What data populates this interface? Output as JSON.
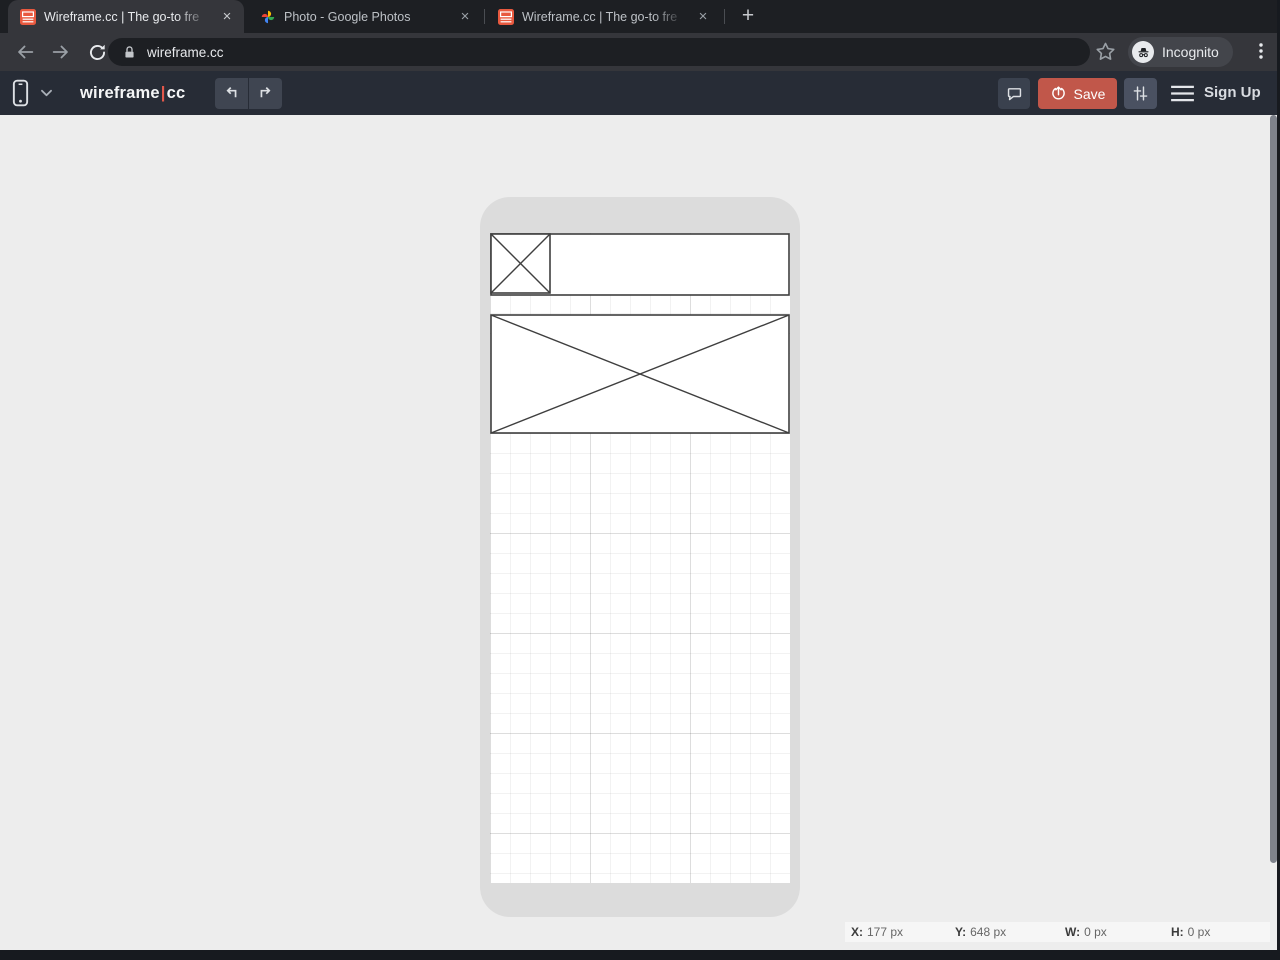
{
  "browser": {
    "tabs": [
      {
        "title": "Wireframe.cc | The go-to fre",
        "favicon": "wireframe",
        "active": true
      },
      {
        "title": "Photo - Google Photos",
        "favicon": "google-photos",
        "active": false
      },
      {
        "title": "Wireframe.cc | The go-to fre",
        "favicon": "wireframe",
        "active": false
      }
    ],
    "close_glyph": "×",
    "new_tab_glyph": "+",
    "url": "wireframe.cc",
    "incognito_label": "Incognito"
  },
  "toolbar": {
    "logo_left": "wireframe",
    "logo_cursor": "|",
    "logo_right": "cc",
    "save_label": "Save",
    "signup_label": "Sign Up"
  },
  "status_bar": {
    "items": [
      {
        "label": "X:",
        "value": "177 px"
      },
      {
        "label": "Y:",
        "value": "648 px"
      },
      {
        "label": "W:",
        "value": "0 px"
      },
      {
        "label": "H:",
        "value": "0 px"
      }
    ]
  },
  "colors": {
    "save_button": "#c1574a",
    "logo_cursor": "#e2574a",
    "wireframe_favicon": "#e8593f",
    "app_toolbar": "#272c36",
    "chrome_dark": "#1d1f23",
    "chrome_light": "#35363b",
    "canvas_bg": "#ededed",
    "device_frame": "#dcdcdc",
    "wireframe_stroke": "#3f3f3f",
    "google_red": "#ea4335",
    "google_yellow": "#fbbc04",
    "google_green": "#34a853",
    "google_blue": "#4285f4"
  }
}
